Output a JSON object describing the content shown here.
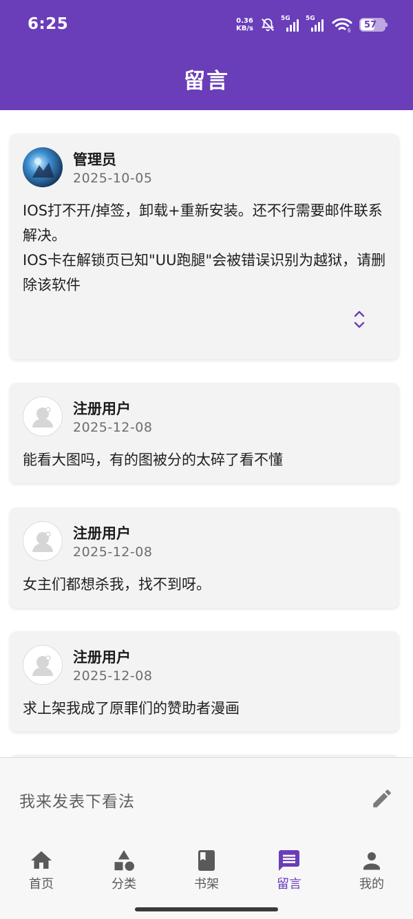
{
  "status_bar": {
    "time": "6:25",
    "net_speed_value": "0.36",
    "net_speed_unit": "KB/s",
    "sim1_label": "5G",
    "sim2_label": "5G",
    "wifi_label": "6",
    "battery": "57"
  },
  "header": {
    "title": "留言"
  },
  "messages": [
    {
      "user": "管理员",
      "date": "2025-10-05",
      "content": "IOS打不开/掉签，卸载+重新安装。还不行需要邮件联系解决。\nIOS卡在解锁页已知\"UU跑腿\"会被错误识别为越狱，请删除该软件",
      "avatar": "admin-avatar"
    },
    {
      "user": "注册用户",
      "date": "2025-12-08",
      "content": "能看大图吗，有的图被分的太碎了看不懂",
      "avatar": "default-avatar"
    },
    {
      "user": "注册用户",
      "date": "2025-12-08",
      "content": "女主们都想杀我，找不到呀。",
      "avatar": "default-avatar"
    },
    {
      "user": "注册用户",
      "date": "2025-12-08",
      "content": "求上架我成了原罪们的赞助者漫画",
      "avatar": "default-avatar"
    }
  ],
  "comment_bar": {
    "placeholder": "我来发表下看法",
    "icon": "pencil-icon"
  },
  "bottom_nav": [
    {
      "label": "首页",
      "icon": "home-icon",
      "active": false
    },
    {
      "label": "分类",
      "icon": "category-icon",
      "active": false
    },
    {
      "label": "书架",
      "icon": "bookshelf-icon",
      "active": false
    },
    {
      "label": "留言",
      "icon": "message-icon",
      "active": true
    },
    {
      "label": "我的",
      "icon": "profile-icon",
      "active": false
    }
  ],
  "colors": {
    "primary": "#6a3db9",
    "card_bg": "#f3f3f3",
    "nav_inactive": "#5a5a5a"
  }
}
